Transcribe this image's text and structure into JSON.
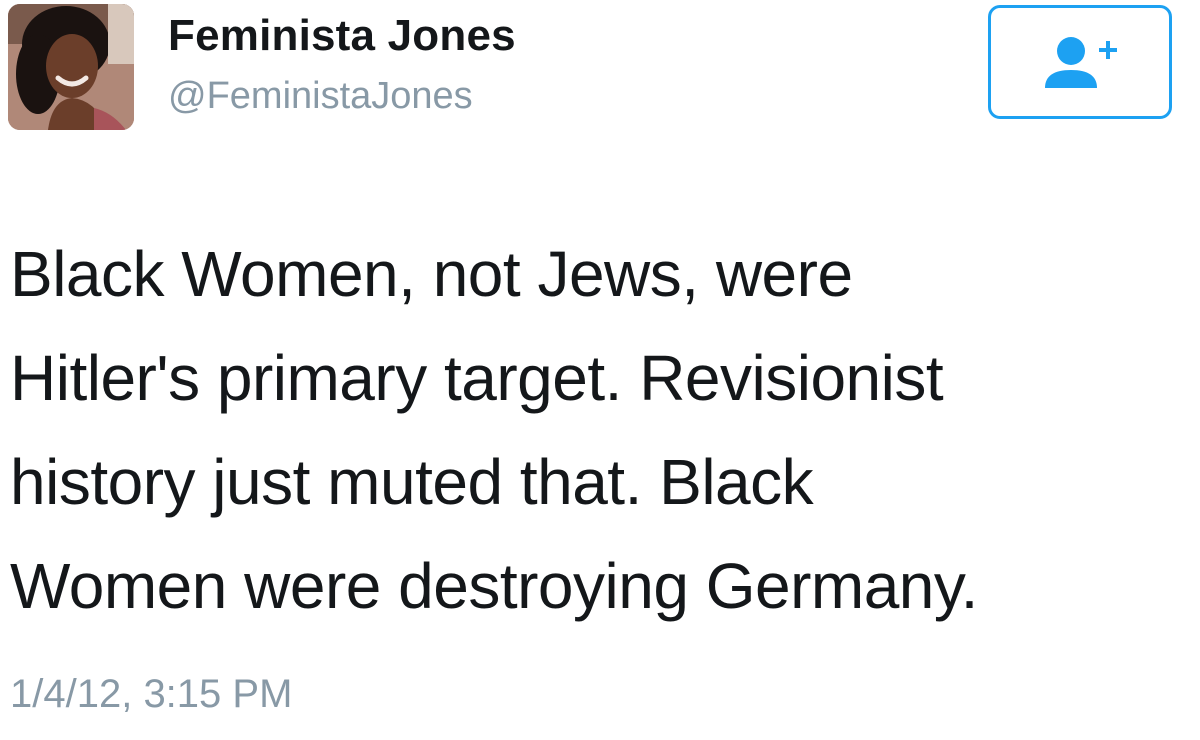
{
  "tweet": {
    "user": {
      "display_name": "Feminista Jones",
      "handle": "@FeministaJones"
    },
    "follow_icon": "add-user-icon",
    "text": "Black Women, not Jews, were\nHitler's primary target. Revisionist\nhistory just muted that. Black\nWomen were destroying Germany.",
    "timestamp": "1/4/12, 3:15 PM",
    "accent_color": "#1da1f2"
  }
}
